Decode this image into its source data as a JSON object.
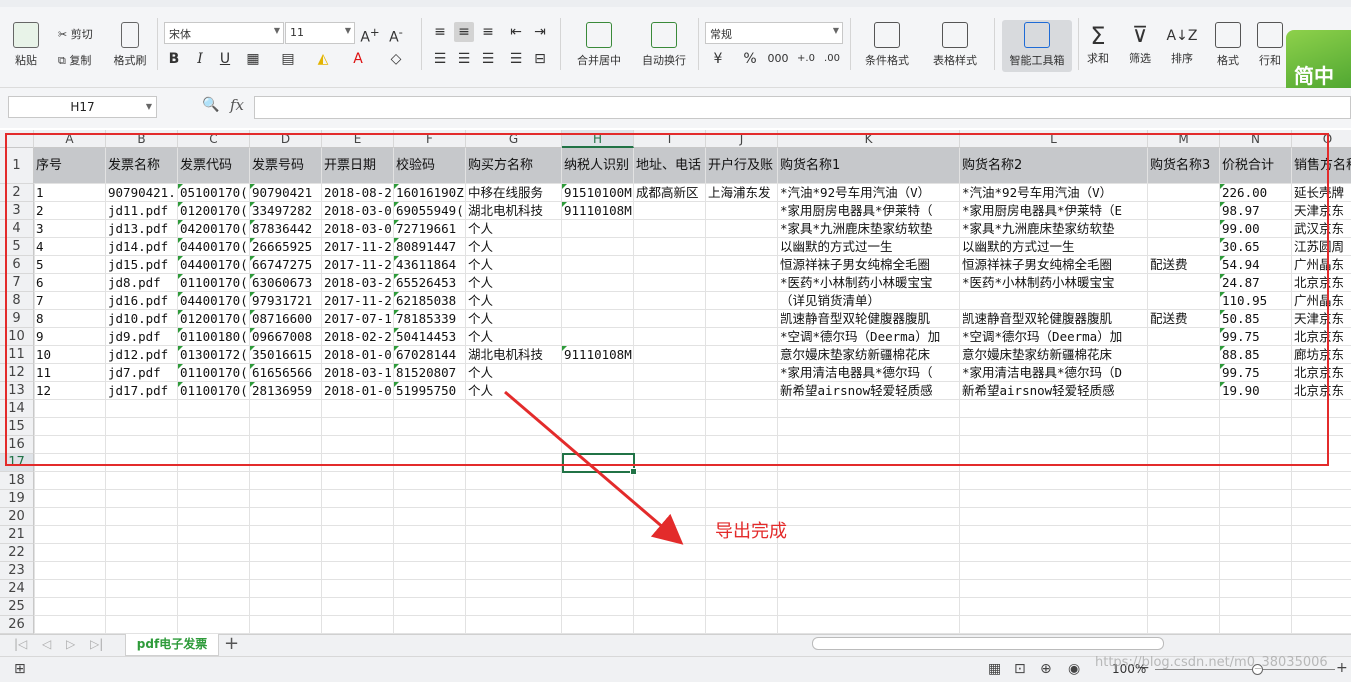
{
  "ribbon": {
    "paste": "粘贴",
    "cut": "剪切",
    "copy": "复制",
    "format_painter": "格式刷",
    "font_name": "宋体",
    "font_size": "11",
    "merge_center": "合并居中",
    "wrap_text": "自动换行",
    "number_format": "常规",
    "conditional_format": "条件格式",
    "table_style": "表格样式",
    "smart_toolbox": "智能工具箱",
    "sum": "求和",
    "filter": "筛选",
    "sort": "排序",
    "format": "格式",
    "rows_cols": "行和",
    "percent": "%",
    "thousands": "000",
    "ad_text": "简中设"
  },
  "formula_bar": {
    "cell_ref": "H17",
    "fx": "fx",
    "formula": ""
  },
  "columns": [
    "A",
    "B",
    "C",
    "D",
    "E",
    "F",
    "G",
    "H",
    "I",
    "J",
    "K",
    "L",
    "M",
    "N",
    "O"
  ],
  "selected_column": "H",
  "row_numbers": [
    "1",
    "2",
    "3",
    "4",
    "5",
    "6",
    "7",
    "8",
    "9",
    "10",
    "11",
    "12",
    "13",
    "14",
    "15",
    "16",
    "17",
    "18",
    "19",
    "20",
    "21",
    "22",
    "23",
    "24",
    "25",
    "26"
  ],
  "headers": [
    "序号",
    "发票名称",
    "发票代码",
    "发票号码",
    "开票日期",
    "校验码",
    "购买方名称",
    "纳税人识别号",
    "地址、电话",
    "开户行及账户",
    "购货名称1",
    "购货名称2",
    "购货名称3",
    "价税合计",
    "销售方名称"
  ],
  "rows": [
    [
      "1",
      "90790421.",
      "05100170(",
      "90790421",
      "2018-08-2",
      "16016190Z",
      "中移在线服务",
      "91510100M",
      "成都高新区",
      "上海浦东发",
      "*汽油*92号车用汽油（V）",
      "*汽油*92号车用汽油（V）",
      "",
      "226.00",
      "延长壳牌"
    ],
    [
      "2",
      "jd11.pdf",
      "01200170(",
      "33497282",
      "2018-03-0",
      "69055949(",
      "湖北电机科技",
      "91110108M",
      "",
      "",
      "*家用厨房电器具*伊莱特（",
      "*家用厨房电器具*伊莱特（E",
      "",
      "98.97",
      "天津京东"
    ],
    [
      "3",
      "jd13.pdf",
      "04200170(",
      "87836442",
      "2018-03-0",
      "72719661",
      "个人",
      "",
      "",
      "",
      "*家具*九洲鹿床垫家纺软垫",
      "*家具*九洲鹿床垫家纺软垫",
      "",
      "99.00",
      "武汉京东"
    ],
    [
      "4",
      "jd14.pdf",
      "04400170(",
      "26665925",
      "2017-11-2",
      "80891447",
      "个人",
      "",
      "",
      "",
      "以幽默的方式过一生",
      "以幽默的方式过一生",
      "",
      "30.65",
      "江苏圆周"
    ],
    [
      "5",
      "jd15.pdf",
      "04400170(",
      "66747275",
      "2017-11-2",
      "43611864",
      "个人",
      "",
      "",
      "",
      "恒源祥袜子男女纯棉全毛圈",
      "恒源祥袜子男女纯棉全毛圈",
      "配送费",
      "54.94",
      "广州晶东"
    ],
    [
      "6",
      "jd8.pdf",
      "01100170(",
      "63060673",
      "2018-03-2",
      "65526453",
      "个人",
      "",
      "",
      "",
      "*医药*小林制药小林暖宝宝",
      "*医药*小林制药小林暖宝宝",
      "",
      "24.87",
      "北京京东"
    ],
    [
      "7",
      "jd16.pdf",
      "04400170(",
      "97931721",
      "2017-11-2",
      "62185038",
      "个人",
      "",
      "",
      "",
      "（详见销货清单）",
      "",
      "",
      "110.95",
      "广州晶东"
    ],
    [
      "8",
      "jd10.pdf",
      "01200170(",
      "08716600",
      "2017-07-1",
      "78185339",
      "个人",
      "",
      "",
      "",
      "凯速静音型双轮健腹器腹肌",
      "凯速静音型双轮健腹器腹肌",
      "配送费",
      "50.85",
      "天津京东"
    ],
    [
      "9",
      "jd9.pdf",
      "01100180(",
      "09667008",
      "2018-02-2",
      "50414453",
      "个人",
      "",
      "",
      "",
      "*空调*德尔玛（Deerma）加",
      "*空调*德尔玛（Deerma）加",
      "",
      "99.75",
      "北京京东"
    ],
    [
      "10",
      "jd12.pdf",
      "01300172(",
      "35016615",
      "2018-01-0",
      "67028144",
      "湖北电机科技",
      "91110108M",
      "",
      "",
      "意尔嫚床垫家纺新疆棉花床",
      "意尔嫚床垫家纺新疆棉花床",
      "",
      "88.85",
      "廊坊京东"
    ],
    [
      "11",
      "jd7.pdf",
      "01100170(",
      "61656566",
      "2018-03-1",
      "81520807",
      "个人",
      "",
      "",
      "",
      "*家用清洁电器具*德尔玛（",
      "*家用清洁电器具*德尔玛（D",
      "",
      "99.75",
      "北京京东"
    ],
    [
      "12",
      "jd17.pdf",
      "01100170(",
      "28136959",
      "2018-01-0",
      "51995750",
      "个人",
      "",
      "",
      "",
      "新希望airsnow轻爱轻质感",
      "新希望airsnow轻爱轻质感",
      "",
      "19.90",
      "北京京东"
    ]
  ],
  "annotation": {
    "text": "导出完成",
    "color": "#e32b2b"
  },
  "sheet_tab": "pdf电子发票",
  "add_sheet": "+",
  "status": {
    "zoom": "100%",
    "watermark": "https://blog.csdn.net/m0_38035006"
  },
  "colors": {
    "accent": "#217346",
    "tab_green": "#2e9b3a",
    "annotation_red": "#e32b2b"
  }
}
